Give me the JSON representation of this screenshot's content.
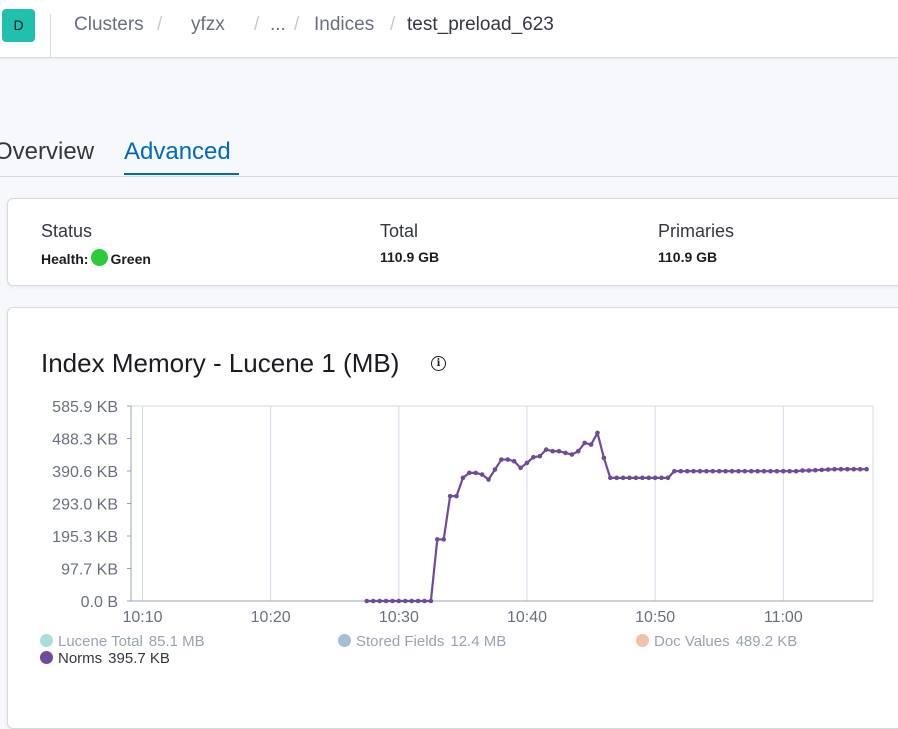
{
  "header": {
    "logo_letter": "D",
    "breadcrumbs": [
      "Clusters",
      "yfzx",
      "...",
      "Indices"
    ],
    "current": "test_preload_623"
  },
  "tabs": [
    {
      "label": "Overview",
      "active": false
    },
    {
      "label": "Advanced",
      "active": true
    }
  ],
  "summary": {
    "status_title": "Status",
    "health_label": "Health:",
    "health_value": "Green",
    "health_color": "#2bcc3a",
    "total_title": "Total",
    "total_value": "110.9 GB",
    "primaries_title": "Primaries",
    "primaries_value": "110.9 GB"
  },
  "chart_panel": {
    "title": "Index Memory - Lucene 1 (MB)",
    "info_icon": "info-icon"
  },
  "chart_data": {
    "type": "line",
    "title": "Index Memory - Lucene 1 (MB)",
    "x_ticks": [
      "10:10",
      "10:20",
      "10:30",
      "10:40",
      "10:50",
      "11:00"
    ],
    "y_ticks": [
      "585.9 KB",
      "488.3 KB",
      "390.6 KB",
      "293.0 KB",
      "195.3 KB",
      "97.7 KB",
      "0.0 B"
    ],
    "ylim_kb": [
      0,
      585.9
    ],
    "xlim_minutes": [
      "10:10",
      "11:07"
    ],
    "grid": true,
    "legend_placement": "bottom",
    "series": [
      {
        "name": "Lucene Total",
        "value": "85.1 MB",
        "color": "#a8dfdc",
        "enabled": false
      },
      {
        "name": "Stored Fields",
        "value": "12.4 MB",
        "color": "#a5bfd9",
        "enabled": false
      },
      {
        "name": "Doc Values",
        "value": "489.2 KB",
        "color": "#f2c2a8",
        "enabled": false
      },
      {
        "name": "Norms",
        "value": "395.7 KB",
        "color": "#6e4b99",
        "enabled": true,
        "x": [
          "10:27:30",
          "10:28:00",
          "10:28:30",
          "10:29:00",
          "10:29:30",
          "10:30:00",
          "10:30:30",
          "10:31:00",
          "10:31:30",
          "10:32:00",
          "10:32:30",
          "10:33:00",
          "10:33:30",
          "10:34:00",
          "10:34:30",
          "10:35:00",
          "10:35:30",
          "10:36:00",
          "10:36:30",
          "10:37:00",
          "10:37:30",
          "10:38:00",
          "10:38:30",
          "10:39:00",
          "10:39:30",
          "10:40:00",
          "10:40:30",
          "10:41:00",
          "10:41:30",
          "10:42:00",
          "10:42:30",
          "10:43:00",
          "10:43:30",
          "10:44:00",
          "10:44:30",
          "10:45:00",
          "10:45:30",
          "10:46:00",
          "10:46:30",
          "10:47:00",
          "10:47:30",
          "10:48:00",
          "10:48:30",
          "10:49:00",
          "10:49:30",
          "10:50:00",
          "10:50:30",
          "10:51:00",
          "10:51:30",
          "10:52:00",
          "10:52:30",
          "10:53:00",
          "10:53:30",
          "10:54:00",
          "10:54:30",
          "10:55:00",
          "10:55:30",
          "10:56:00",
          "10:56:30",
          "10:57:00",
          "10:57:30",
          "10:58:00",
          "10:58:30",
          "10:59:00",
          "10:59:30",
          "11:00:00",
          "11:00:30",
          "11:01:00",
          "11:01:30",
          "11:02:00",
          "11:02:30",
          "11:03:00",
          "11:03:30",
          "11:04:00",
          "11:04:30",
          "11:05:00",
          "11:05:30",
          "11:06:00",
          "11:06:30"
        ],
        "y_kb": [
          0,
          0,
          0,
          0,
          0,
          0,
          0,
          0,
          0,
          0,
          0,
          185,
          185,
          315,
          315,
          370,
          385,
          385,
          380,
          365,
          395,
          425,
          425,
          420,
          400,
          415,
          432,
          435,
          455,
          450,
          450,
          445,
          440,
          450,
          475,
          470,
          505,
          430,
          370,
          370,
          370,
          370,
          370,
          370,
          370,
          370,
          370,
          370,
          390,
          390,
          390,
          390,
          390,
          390,
          390,
          390,
          390,
          390,
          390,
          390,
          390,
          390,
          390,
          390,
          390,
          390,
          390,
          390,
          392,
          392,
          393,
          394,
          395,
          396,
          396,
          396,
          396,
          396,
          396,
          396,
          396
        ]
      }
    ]
  }
}
